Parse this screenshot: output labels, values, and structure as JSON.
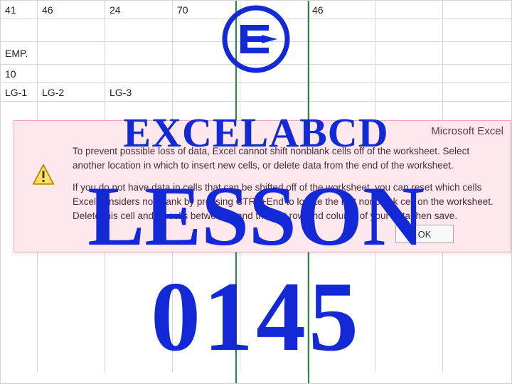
{
  "sheet": {
    "rows": [
      [
        "41",
        "46",
        "24",
        "70",
        "",
        "46",
        ""
      ],
      [
        "",
        "",
        "",
        "",
        "",
        "",
        ""
      ],
      [
        "EMP.",
        "",
        "",
        "",
        "",
        "",
        ""
      ],
      [
        "10",
        "",
        "",
        "",
        "",
        "",
        ""
      ],
      [
        "LG-1",
        "LG-2",
        "LG-3",
        "",
        "",
        "",
        ""
      ]
    ]
  },
  "dialog": {
    "title": "Microsoft Excel",
    "line1": "To prevent possible loss of data, Excel cannot shift nonblank cells off of the worksheet. Select another location in which to insert new cells, or delete data from the end of the worksheet.",
    "line2": "If you do not have data in cells that can be shifted off of the worksheet, you can reset which cells Excel considers nonblank by pressing CTRL+End to locate the last nonblank cell on the worksheet. Delete this cell and all cells between it and the last row and column of your data then save.",
    "button": "OK"
  },
  "overlay": {
    "brand": "EXCELABCD",
    "lesson": "LESSON",
    "number": "0145"
  }
}
